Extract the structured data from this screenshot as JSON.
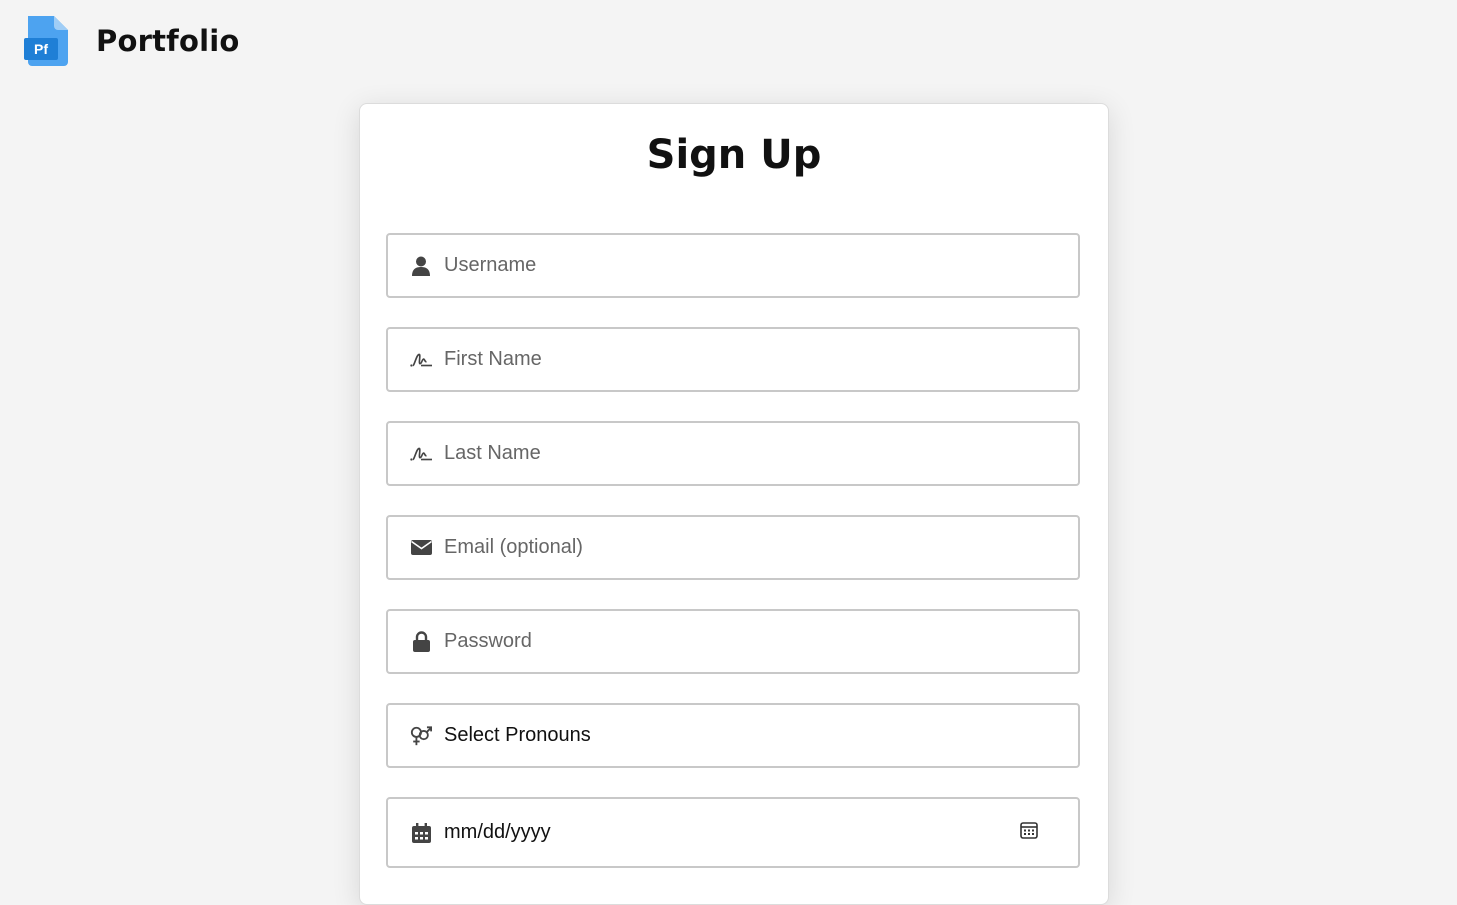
{
  "brand": {
    "logo_text": "Pf",
    "title": "Portfolio"
  },
  "form": {
    "title": "Sign Up",
    "fields": [
      {
        "name": "username",
        "icon": "user-icon",
        "placeholder": "Username"
      },
      {
        "name": "first-name",
        "icon": "signature-icon",
        "placeholder": "First Name"
      },
      {
        "name": "last-name",
        "icon": "signature-icon",
        "placeholder": "Last Name"
      },
      {
        "name": "email",
        "icon": "envelope-icon",
        "placeholder": "Email (optional)"
      },
      {
        "name": "password",
        "icon": "lock-icon",
        "placeholder": "Password"
      },
      {
        "name": "pronouns",
        "icon": "gender-icon",
        "value": "Select Pronouns"
      },
      {
        "name": "birthdate",
        "icon": "calendar-icon",
        "value": "mm/dd/yyyy"
      }
    ]
  },
  "colors": {
    "background": "#f4f4f4",
    "logo_blue": "#4da3f0",
    "logo_dark_blue": "#1f7fd6",
    "icon": "#444444"
  }
}
